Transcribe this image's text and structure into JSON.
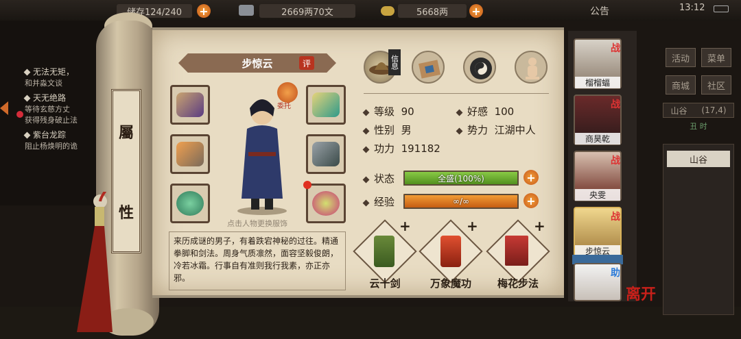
{
  "topbar": {
    "bag": "储存124/240",
    "money": "2669两70文",
    "gold": "5668两",
    "announce": "公告",
    "clock": "13:12"
  },
  "quests": [
    {
      "title": "无法无矩，",
      "sub": "和并淼文谈"
    },
    {
      "title": "天无绝路",
      "sub": "等待玄慈方丈"
    },
    {
      "title": "",
      "sub": "获得残身破止法"
    },
    {
      "title": "紫台龙踪",
      "sub": "阻止杨焕明的诡"
    }
  ],
  "attr_tab": {
    "c1": "屬",
    "c2": "性"
  },
  "character": {
    "name": "步惊云",
    "rate": "评",
    "delegate": "委托",
    "hint": "点击人物更换服饰",
    "desc": "来历成谜的男子，有着跌宕神秘的过往。精通拳脚和剑法。周身气质凛然，面容坚毅俊朗，冷若冰霜。行事自有准则我行我素，亦正亦邪。"
  },
  "tabs": {
    "info": "信息"
  },
  "stats": {
    "level_label": "等级",
    "level": "90",
    "favor_label": "好感",
    "favor": "100",
    "gender_label": "性别",
    "gender": "男",
    "faction_label": "势力",
    "faction": "江湖中人",
    "power_label": "功力",
    "power": "191182",
    "state_label": "状态",
    "state": "全盛(100%)",
    "state_fill": 1.0,
    "exp_label": "经验",
    "exp": "∞/∞",
    "exp_fill": 1.0
  },
  "skills": [
    {
      "name": "云十剑"
    },
    {
      "name": "万象魔功"
    },
    {
      "name": "梅花步法"
    }
  ],
  "party": [
    {
      "name": "榴榴蝠",
      "tag": "战"
    },
    {
      "name": "商昊乾",
      "tag": "战"
    },
    {
      "name": "央雯",
      "tag": "战"
    },
    {
      "name": "步惊云",
      "tag": "战"
    },
    {
      "name": "",
      "tag": "助"
    }
  ],
  "leave": "离开",
  "menu": {
    "activity": "活动",
    "menu": "菜单",
    "shop": "商城",
    "community": "社区"
  },
  "location": {
    "name": "山谷",
    "coords": "(17,4)",
    "button": "山谷",
    "time": "丑 时"
  },
  "colors": {
    "state_bar": "#6fae2a",
    "exp_bar": "#e07a18",
    "accent_plus": "#e88a24",
    "dialog_paper": "#e8dcc3"
  }
}
